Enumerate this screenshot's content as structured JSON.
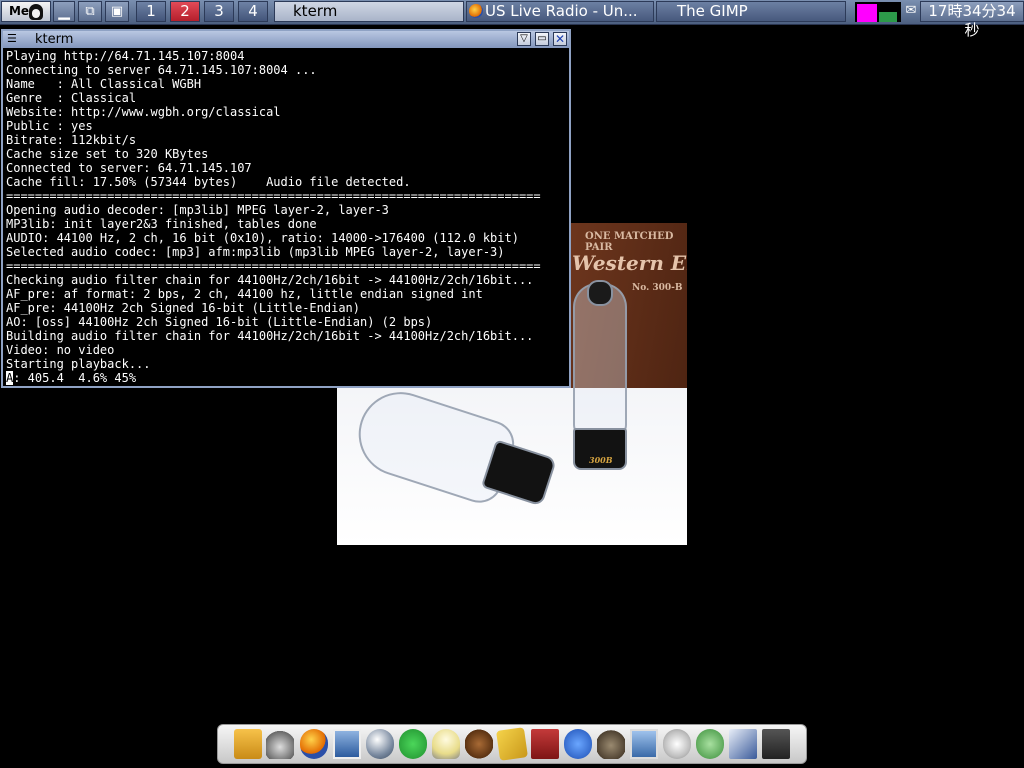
{
  "panel": {
    "menu_label": "Me",
    "workspaces": [
      {
        "label": "1",
        "active": false
      },
      {
        "label": "2",
        "active": true
      },
      {
        "label": "3",
        "active": false
      },
      {
        "label": "4",
        "active": false
      }
    ],
    "tasks": [
      {
        "label": "kterm",
        "active": true
      },
      {
        "label": "US Live Radio - Un...",
        "active": false
      },
      {
        "label": "The GIMP",
        "active": false
      }
    ],
    "clock": "17時34分34秒"
  },
  "kterm": {
    "title": "kterm",
    "lines": [
      "Playing http://64.71.145.107:8004",
      "Connecting to server 64.71.145.107:8004 ...",
      "Name   : All Classical WGBH",
      "Genre  : Classical",
      "Website: http://www.wgbh.org/classical",
      "Public : yes",
      "Bitrate: 112kbit/s",
      "Cache size set to 320 KBytes",
      "Connected to server: 64.71.145.107",
      "Cache fill: 17.50% (57344 bytes)    Audio file detected.",
      "==========================================================================",
      "Opening audio decoder: [mp3lib] MPEG layer-2, layer-3",
      "MP3lib: init layer2&3 finished, tables done",
      "AUDIO: 44100 Hz, 2 ch, 16 bit (0x10), ratio: 14000->176400 (112.0 kbit)",
      "Selected audio codec: [mp3] afm:mp3lib (mp3lib MPEG layer-2, layer-3)",
      "==========================================================================",
      "Checking audio filter chain for 44100Hz/2ch/16bit -> 44100Hz/2ch/16bit...",
      "AF_pre: af format: 2 bps, 2 ch, 44100 hz, little endian signed int",
      "AF_pre: 44100Hz 2ch Signed 16-bit (Little-Endian)",
      "AO: [oss] 44100Hz 2ch Signed 16-bit (Little-Endian) (2 bps)",
      "Building audio filter chain for 44100Hz/2ch/16bit -> 44100Hz/2ch/16bit...",
      "Video: no video",
      "Starting playback..."
    ],
    "status_cursor": "A",
    "status_line": ": 405.4  4.6% 45%"
  },
  "photo": {
    "stamp_top": "ONE MATCHED PAIR",
    "stamp_brand": "Western Electric",
    "stamp_model": "No. 300-B",
    "tube_label": "300B"
  },
  "dock": {
    "icons": [
      "file-manager-icon",
      "game-controller-icon",
      "firefox-icon",
      "image-viewer-icon",
      "globe-icon",
      "skype-icon",
      "lightbulb-icon",
      "gnu-icon",
      "notes-icon",
      "dictionary-icon",
      "search-icon",
      "gimp-icon",
      "photo-icon",
      "compass-icon",
      "music-icon",
      "drawing-icon",
      "video-icon"
    ]
  },
  "colors": {
    "panel": "#5d6f90",
    "active_workspace": "#d0303d",
    "tray_cpu": "#ff00ff"
  }
}
